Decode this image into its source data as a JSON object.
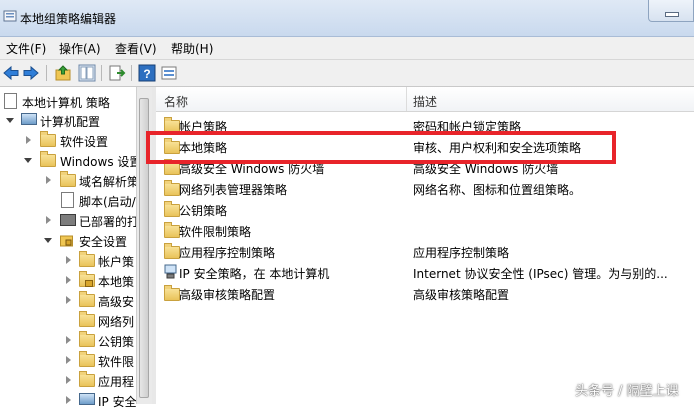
{
  "window": {
    "title": "本地组策略编辑器"
  },
  "menu": [
    "文件(F)",
    "操作(A)",
    "查看(V)",
    "帮助(H)"
  ],
  "toolbar": [
    "back-arrow-icon",
    "forward-arrow-icon",
    "up-folder-icon",
    "show-hide-tree-icon",
    "export-list-icon",
    "help-icon",
    "properties-icon"
  ],
  "tree": [
    "本地计算机 策略",
    "计算机配置",
    "软件设置",
    "Windows 设置",
    "域名解析策",
    "脚本(启动/",
    "已部署的打",
    "安全设置",
    "帐户策",
    "本地策",
    "高级安",
    "网络列",
    "公钥策",
    "软件限",
    "应用程",
    "IP 安全"
  ],
  "columns": {
    "name": "名称",
    "desc": "描述"
  },
  "rows": [
    {
      "name": "帐户策略",
      "desc": "密码和帐户锁定策略"
    },
    {
      "name": "本地策略",
      "desc": "审核、用户权利和安全选项策略"
    },
    {
      "name": "高级安全 Windows 防火墙",
      "desc": "高级安全 Windows 防火墙"
    },
    {
      "name": "网络列表管理器策略",
      "desc": "网络名称、图标和位置组策略。"
    },
    {
      "name": "公钥策略",
      "desc": ""
    },
    {
      "name": "软件限制策略",
      "desc": ""
    },
    {
      "name": "应用程序控制策略",
      "desc": "应用程序控制策略"
    },
    {
      "name": "IP 安全策略，在 本地计算机",
      "desc": "Internet 协议安全性 (IPsec) 管理。为与别的..."
    },
    {
      "name": "高级审核策略配置",
      "desc": "高级审核策略配置"
    }
  ],
  "watermark": "头条号 / 隔壁上课",
  "accent": "#e8242a"
}
